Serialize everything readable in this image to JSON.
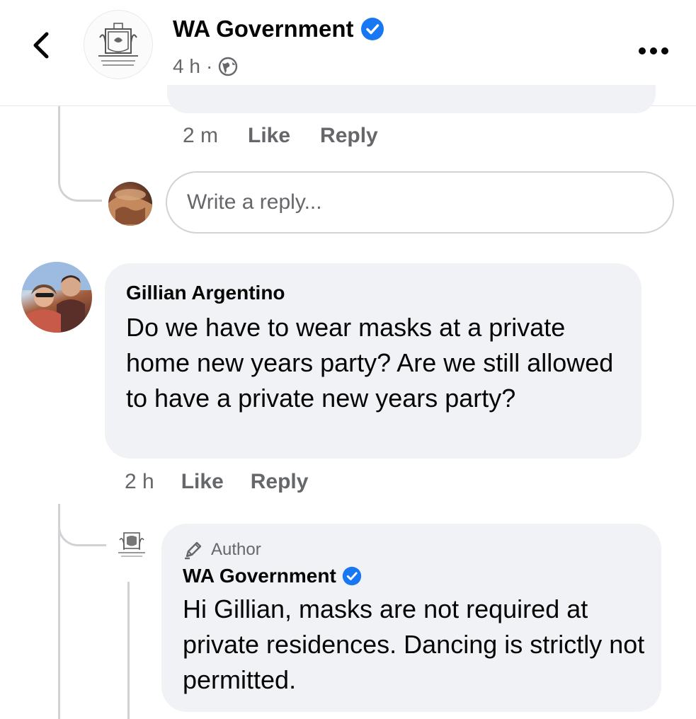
{
  "header": {
    "page_name": "WA Government",
    "time": "4 h",
    "separator": "·",
    "icons": [
      "chevron-left-icon",
      "government-crest-logo",
      "verified-badge-icon",
      "globe-icon",
      "more-options-icon"
    ]
  },
  "previous_comment": {
    "time": "2 m",
    "like_label": "Like",
    "reply_label": "Reply"
  },
  "reply_box": {
    "placeholder": "Write a reply..."
  },
  "comment": {
    "author": "Gillian Argentino",
    "text": "Do we have to wear masks at a private home new years party?  Are we still allowed to have a private new years party?",
    "time": "2 h",
    "like_label": "Like",
    "reply_label": "Reply"
  },
  "reply": {
    "badge": "Author",
    "author": "WA Government",
    "text": "Hi Gillian, masks are not required at private residences. Dancing is strictly not permitted."
  },
  "colors": {
    "verified": "#1877f2",
    "bubble": "#f0f2f5",
    "secondary_text": "#65676b"
  }
}
